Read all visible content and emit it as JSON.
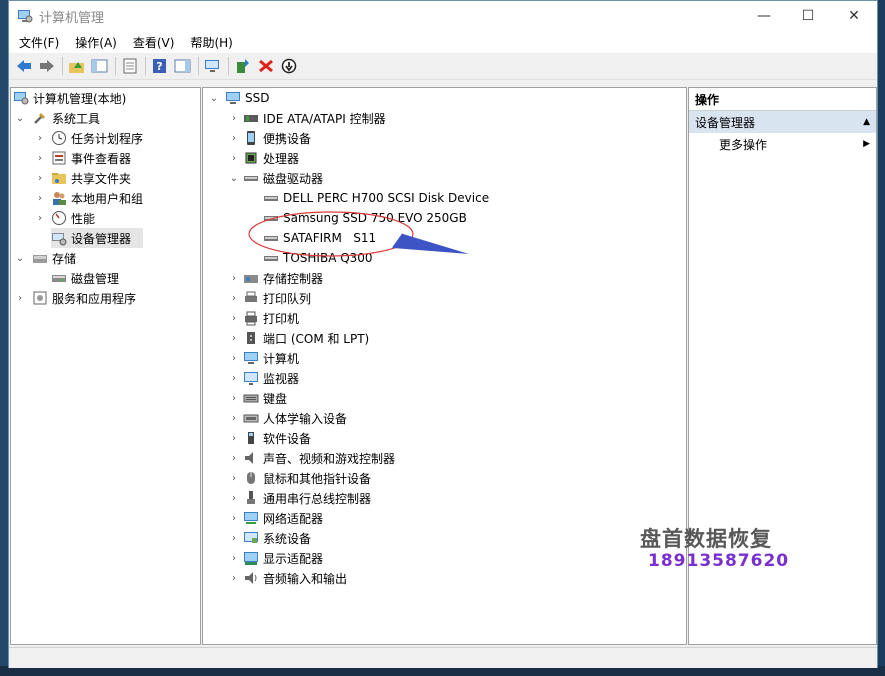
{
  "window": {
    "title": "计算机管理",
    "minimize": "—",
    "maximize": "☐",
    "close": "✕"
  },
  "menu": [
    "文件(F)",
    "操作(A)",
    "查看(V)",
    "帮助(H)"
  ],
  "tree": {
    "root": "计算机管理(本地)",
    "system_tools": "系统工具",
    "task_scheduler": "任务计划程序",
    "event_viewer": "事件查看器",
    "shared_folders": "共享文件夹",
    "local_users": "本地用户和组",
    "performance": "性能",
    "device_manager": "设备管理器",
    "storage": "存储",
    "disk_management": "磁盘管理",
    "services": "服务和应用程序"
  },
  "devices": {
    "root": "SSD",
    "categories": [
      "IDE ATA/ATAPI 控制器",
      "便携设备",
      "处理器",
      "磁盘驱动器",
      "存储控制器",
      "打印队列",
      "打印机",
      "端口 (COM 和 LPT)",
      "计算机",
      "监视器",
      "键盘",
      "人体学输入设备",
      "软件设备",
      "声音、视频和游戏控制器",
      "鼠标和其他指针设备",
      "通用串行总线控制器",
      "网络适配器",
      "系统设备",
      "显示适配器",
      "音频输入和输出"
    ],
    "disks": [
      "DELL PERC H700 SCSI Disk Device",
      "Samsung SSD 750 EVO 250GB",
      "SATAFIRM   S11",
      "TOSHIBA Q300"
    ]
  },
  "actions": {
    "header": "操作",
    "section": "设备管理器",
    "more": "更多操作"
  },
  "watermark": {
    "line1": "盘首数据恢复",
    "line2": "18913587620"
  },
  "colors": {
    "annotation_ellipse": "#d83a3a",
    "annotation_arrow": "#3d55c4",
    "watermark_phone": "#7a2fd0"
  }
}
